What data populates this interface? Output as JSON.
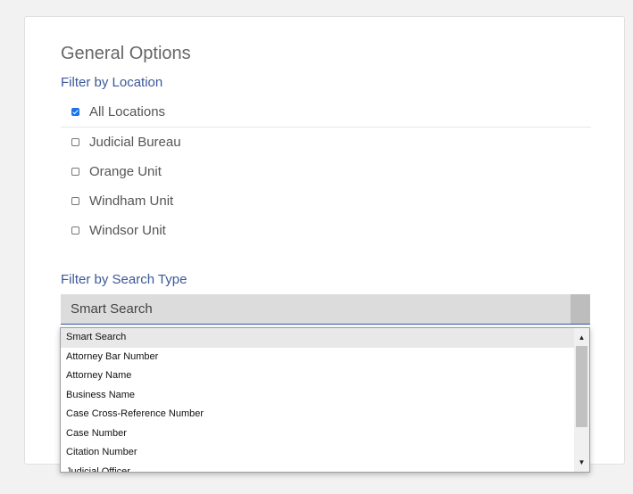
{
  "general": {
    "title": "General Options"
  },
  "location_filter": {
    "label": "Filter by Location",
    "options": [
      {
        "label": "All Locations",
        "checked": true
      },
      {
        "label": "Judicial Bureau",
        "checked": false
      },
      {
        "label": "Orange Unit",
        "checked": false
      },
      {
        "label": "Windham Unit",
        "checked": false
      },
      {
        "label": "Windsor Unit",
        "checked": false
      }
    ]
  },
  "search_type_filter": {
    "label": "Filter by Search Type",
    "selected": "Smart Search",
    "options": [
      "Smart Search",
      "Attorney Bar Number",
      "Attorney Name",
      "Business Name",
      "Case Cross-Reference Number",
      "Case Number",
      "Citation Number",
      "Judicial Officer"
    ]
  },
  "colors": {
    "accent": "#3b5998",
    "checkbox_checked": "#1a73e8"
  },
  "icons": {
    "scroll_up": "▲",
    "scroll_down": "▼"
  }
}
